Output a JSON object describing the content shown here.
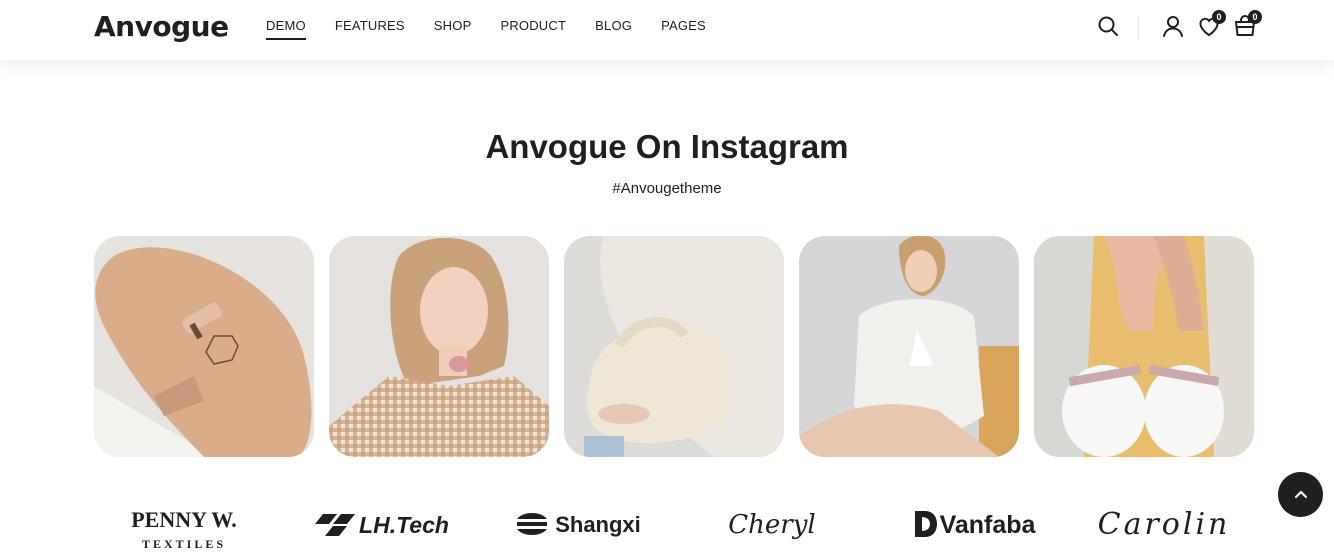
{
  "header": {
    "logo": "Anvogue",
    "nav": [
      "DEMO",
      "FEATURES",
      "SHOP",
      "PRODUCT",
      "BLOG",
      "PAGES"
    ],
    "active_nav": "DEMO",
    "icons": [
      "search-icon",
      "user-icon",
      "heart-icon",
      "cart-icon"
    ],
    "wishlist_count": "0",
    "cart_count": "0"
  },
  "instagram": {
    "title": "Anvogue On Instagram",
    "hashtag": "#Anvougetheme",
    "images": [
      "shoe-sole-photo",
      "model-gingham-blazer-photo",
      "white-handbag-photo",
      "model-white-shirt-photo",
      "ballet-flats-photo"
    ]
  },
  "brands": {
    "penny_line1": "PENNY W.",
    "penny_line2": "TEXTILES",
    "lhtech": "LH.Tech",
    "shangxi": "Shangxi",
    "cheryl": "Cheryl",
    "vanfaba": "Vanfaba",
    "carolin": "Carolin"
  },
  "colors": {
    "text": "#1f1f1f",
    "background": "#ffffff",
    "badge": "#1f1f1f"
  },
  "scroll_top_icon": "chevron-up-icon"
}
